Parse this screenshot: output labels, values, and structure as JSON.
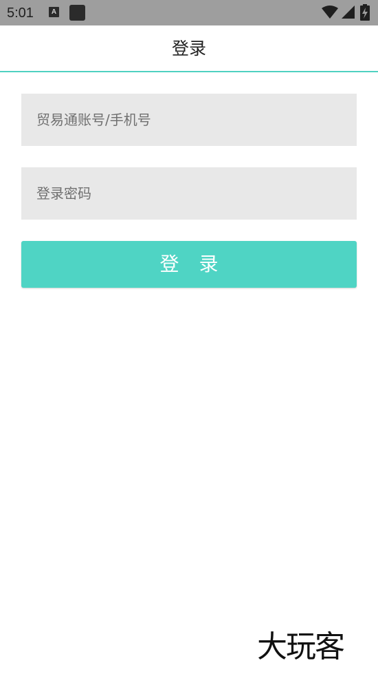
{
  "status_bar": {
    "time": "5:01",
    "a_icon_letter": "A",
    "icons": [
      "a-notification-icon",
      "square-notification-icon",
      "wifi-icon",
      "signal-icon",
      "battery-charging-icon"
    ]
  },
  "app_bar": {
    "title": "登录",
    "accent_color": "#4fd1c1"
  },
  "form": {
    "account_placeholder": "贸易通账号/手机号",
    "account_value": "",
    "password_placeholder": "登录密码",
    "password_value": "",
    "login_label": "登 录",
    "button_color": "#4fd4c4"
  },
  "watermark": {
    "text": "大玩客"
  }
}
